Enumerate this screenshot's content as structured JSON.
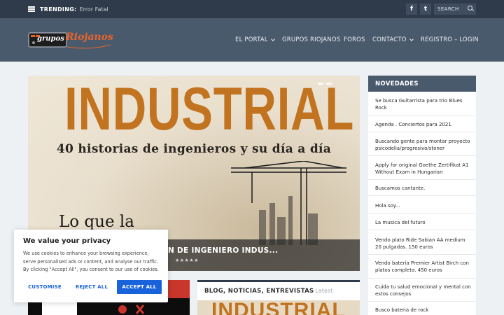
{
  "topbar": {
    "trending_label": "TRENDING:",
    "trending_value": "Error Fatal",
    "search_placeholder": "SEARCH",
    "social": {
      "facebook": "f",
      "twitter": "t"
    }
  },
  "header": {
    "logo_text_a": "grupos",
    "logo_text_b": "Riojanos",
    "nav": [
      {
        "label": "EL PORTAL",
        "has_dropdown": true
      },
      {
        "label": "GRUPOS RIOJANOS",
        "has_dropdown": false
      },
      {
        "label": "FOROS",
        "has_dropdown": false
      },
      {
        "label": "CONTACTO",
        "has_dropdown": true
      },
      {
        "label": "REGISTRO – LOGIN",
        "has_dropdown": false
      }
    ]
  },
  "hero": {
    "title": "INDUSTRIAL",
    "subtitle": "40 historias de ingenieros y su día a día",
    "lead": "Lo que la",
    "caption": "N DE INGENIERO INDUS...",
    "stars": "★★★★★"
  },
  "cards": {
    "mid_title": "BLOG, NOTICIAS, ENTREVISTAS",
    "mid_latest": "Latest",
    "mid_img_text": "INDUSTRIAL"
  },
  "sidebar": {
    "title": "NOVEDADES",
    "items": [
      "Se busca Guitarrista para trio Blues Rock",
      "Agenda . Conciertos para 2021",
      "Buscando gente para montar proyecto psicodelia/progresivo/stoner",
      "Apply for original Goethe Zertifikat A1 Without Exam in Hungarian",
      "Buscamos cantante.",
      "Hola soy...",
      "La musica del futuro",
      "Vendo plato Ride Sabian AA medium 20 pulgadas. 150 euros",
      "Vendo bateria Premier Artist Birch con platos completa. 450 euros",
      "Cuida tu salud emocional y mental con estos consejos",
      "Busco bateria de rock"
    ]
  },
  "cookie": {
    "title": "We value your privacy",
    "text": "We use cookies to enhance your browsing experience, serve personalised ads or content, and analyse our traffic. By clicking \"Accept All\", you consent to our use of cookies.",
    "customise": "CUSTOMISE",
    "reject": "REJECT ALL",
    "accept": "ACCEPT ALL"
  },
  "colors": {
    "topbar": "#2f3b4a",
    "header": "#4a5a6d",
    "accent_orange": "#c2731f",
    "cookie_blue": "#1863dc"
  }
}
